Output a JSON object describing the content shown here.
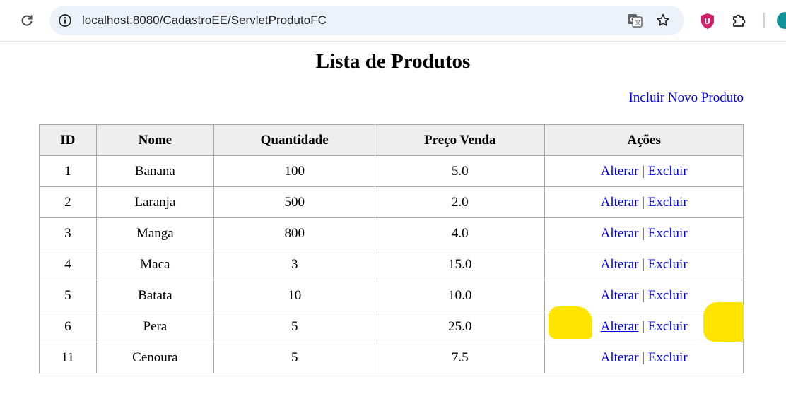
{
  "browser": {
    "url": "localhost:8080/CadastroEE/ServletProdutoFC"
  },
  "page": {
    "title": "Lista de Produtos",
    "new_product_link": "Incluir Novo Produto"
  },
  "table": {
    "headers": {
      "id": "ID",
      "nome": "Nome",
      "quantidade": "Quantidade",
      "preco": "Preço Venda",
      "acoes": "Ações"
    },
    "rows": [
      {
        "id": "1",
        "nome": "Banana",
        "quantidade": "100",
        "preco": "5.0"
      },
      {
        "id": "2",
        "nome": "Laranja",
        "quantidade": "500",
        "preco": "2.0"
      },
      {
        "id": "3",
        "nome": "Manga",
        "quantidade": "800",
        "preco": "4.0"
      },
      {
        "id": "4",
        "nome": "Maca",
        "quantidade": "3",
        "preco": "15.0"
      },
      {
        "id": "5",
        "nome": "Batata",
        "quantidade": "10",
        "preco": "10.0"
      },
      {
        "id": "6",
        "nome": "Pera",
        "quantidade": "5",
        "preco": "25.0"
      },
      {
        "id": "11",
        "nome": "Cenoura",
        "quantidade": "5",
        "preco": "7.5"
      }
    ],
    "action_edit": "Alterar",
    "action_separator": "|",
    "action_delete": "Excluir"
  },
  "colors": {
    "link": "#0000ee",
    "highlight": "#ffe400",
    "header_bg": "#eeeeee"
  }
}
